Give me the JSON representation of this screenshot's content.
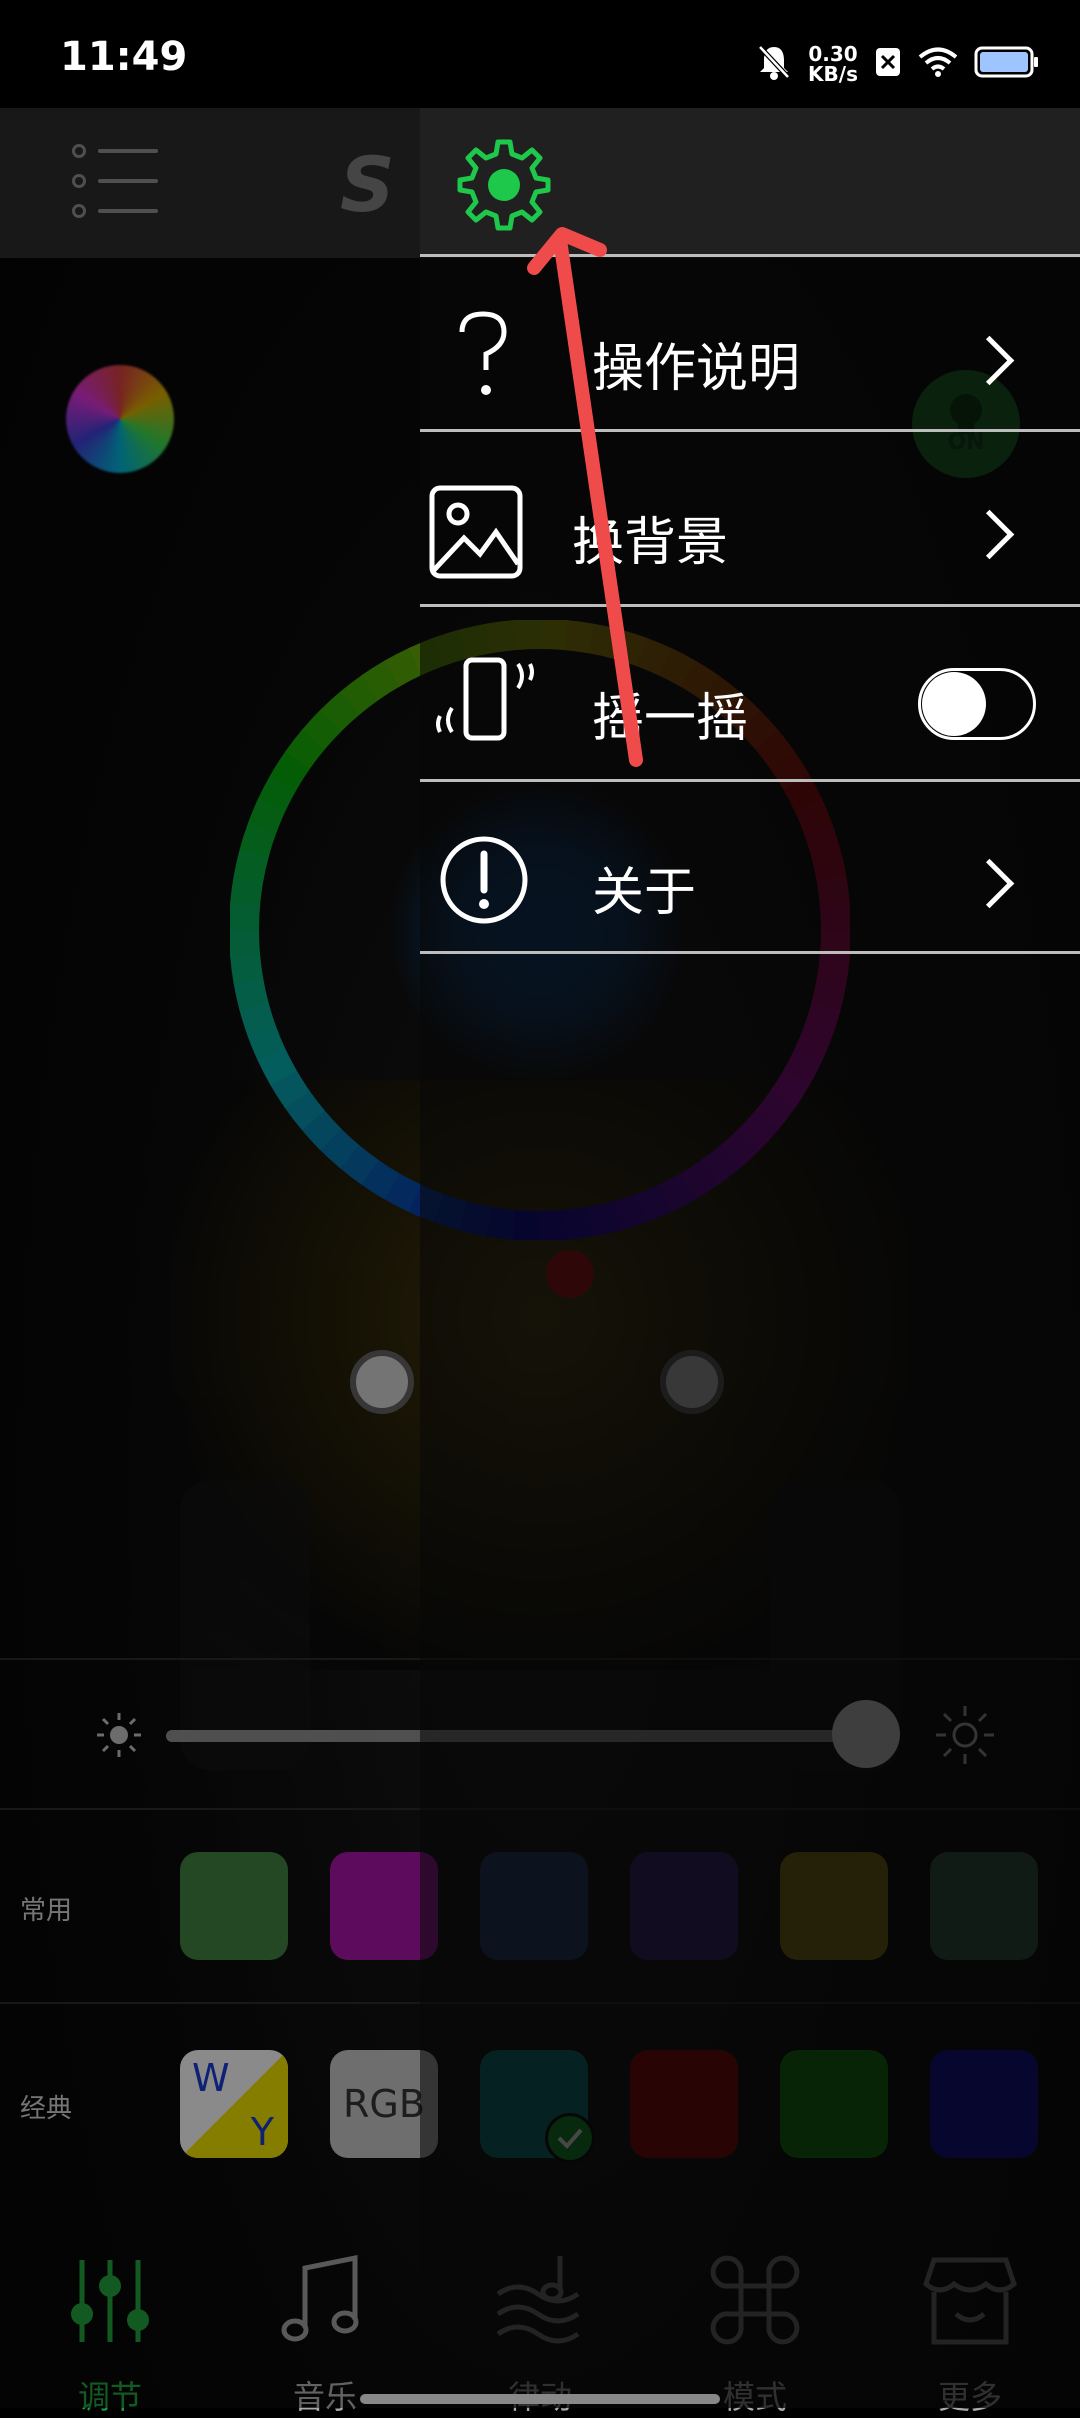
{
  "status_bar": {
    "time": "11:49",
    "net_speed_value": "0.30",
    "net_speed_unit": "KB/s"
  },
  "top_bar": {
    "brand_text": "S"
  },
  "power_button": {
    "label": "ON",
    "color": "#1a8a2c"
  },
  "color_wheel": {
    "center_color": "#0b3a6e"
  },
  "brightness": {
    "level_percent": 100
  },
  "swatches": {
    "common": {
      "label": "常用",
      "colors": [
        "#3e7a3e",
        "#a015a0",
        "#1f3b66",
        "#3a2270",
        "#7a6f10",
        "#2f5a47"
      ]
    },
    "classic": {
      "label": "经典",
      "wy_w": "W",
      "wy_y": "Y",
      "rgb_label": "RGB",
      "colors": [
        "#0b6f70",
        "#8a0000",
        "#0d7a0d",
        "#0a0aa8"
      ],
      "selected_index": 2
    }
  },
  "tabs": [
    {
      "label": "调节",
      "icon": "equalizer-icon",
      "active": true
    },
    {
      "label": "音乐",
      "icon": "music-note-icon",
      "active": false
    },
    {
      "label": "律动",
      "icon": "wave-icon",
      "active": false
    },
    {
      "label": "模式",
      "icon": "command-icon",
      "active": false
    },
    {
      "label": "更多",
      "icon": "store-icon",
      "active": false
    }
  ],
  "drawer": {
    "settings_icon": "gear-icon",
    "items": [
      {
        "label": "操作说明",
        "icon": "question-icon",
        "control": "chevron"
      },
      {
        "label": "换背景",
        "icon": "image-icon",
        "control": "chevron"
      },
      {
        "label": "摇一摇",
        "icon": "shake-phone-icon",
        "control": "toggle",
        "toggle_on": false
      },
      {
        "label": "关于",
        "icon": "info-icon",
        "control": "chevron"
      }
    ]
  },
  "colors": {
    "accent": "#1ec84a",
    "annotation_arrow": "#f04b4b"
  }
}
